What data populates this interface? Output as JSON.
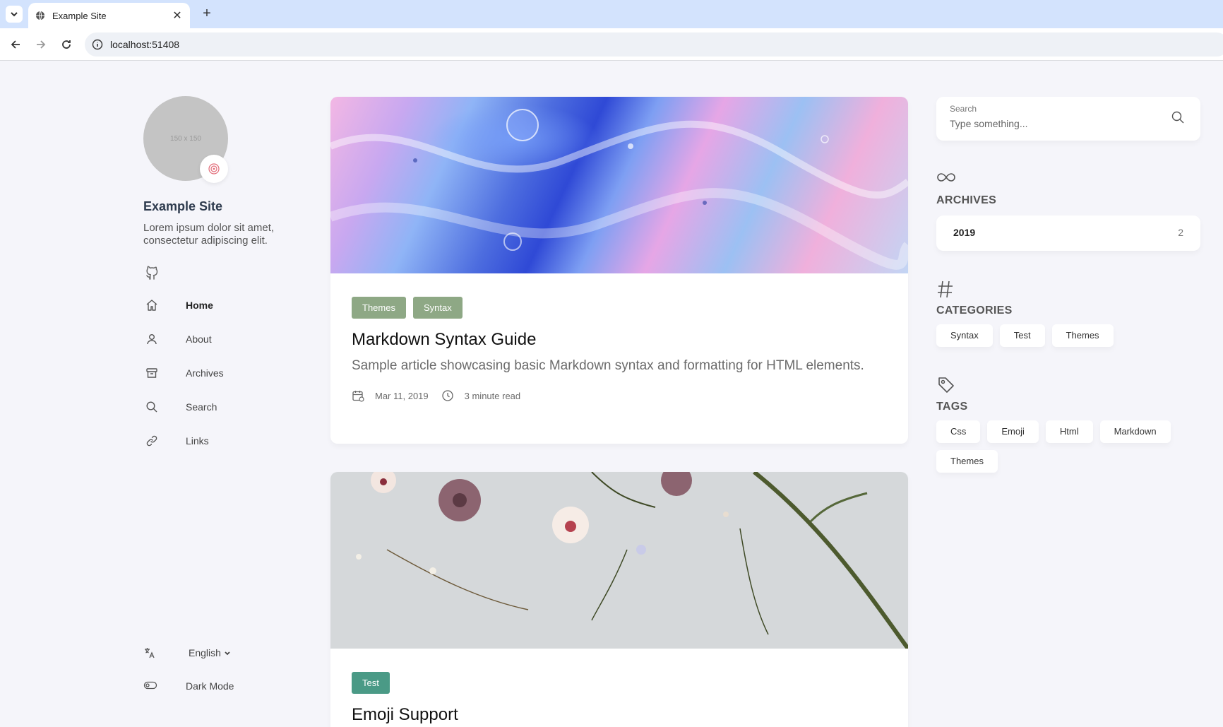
{
  "browser": {
    "tab_title": "Example Site",
    "url": "localhost:51408"
  },
  "sidebar": {
    "avatar_text": "150 x 150",
    "site_name": "Example Site",
    "site_description": "Lorem ipsum dolor sit amet, consectetur adipiscing elit.",
    "menu": [
      {
        "label": "Home",
        "icon": "home-icon",
        "active": true
      },
      {
        "label": "About",
        "icon": "user-icon"
      },
      {
        "label": "Archives",
        "icon": "archive-icon"
      },
      {
        "label": "Search",
        "icon": "search-icon"
      },
      {
        "label": "Links",
        "icon": "link-icon"
      }
    ],
    "language": "English",
    "dark_mode_label": "Dark Mode"
  },
  "articles": [
    {
      "categories": [
        {
          "label": "Themes",
          "color": "#8ea885"
        },
        {
          "label": "Syntax",
          "color": "#8ea885"
        }
      ],
      "title": "Markdown Syntax Guide",
      "description": "Sample article showcasing basic Markdown syntax and formatting for HTML elements.",
      "date": "Mar 11, 2019",
      "read_time": "3 minute read"
    },
    {
      "categories": [
        {
          "label": "Test",
          "color": "#4a9a86"
        }
      ],
      "title": "Emoji Support"
    }
  ],
  "widgets": {
    "search": {
      "label": "Search",
      "placeholder": "Type something..."
    },
    "archives": {
      "title": "ARCHIVES",
      "year": "2019",
      "count": "2"
    },
    "categories": {
      "title": "CATEGORIES",
      "items": [
        "Syntax",
        "Test",
        "Themes"
      ]
    },
    "tags": {
      "title": "TAGS",
      "items": [
        "Css",
        "Emoji",
        "Html",
        "Markdown",
        "Themes"
      ]
    }
  }
}
